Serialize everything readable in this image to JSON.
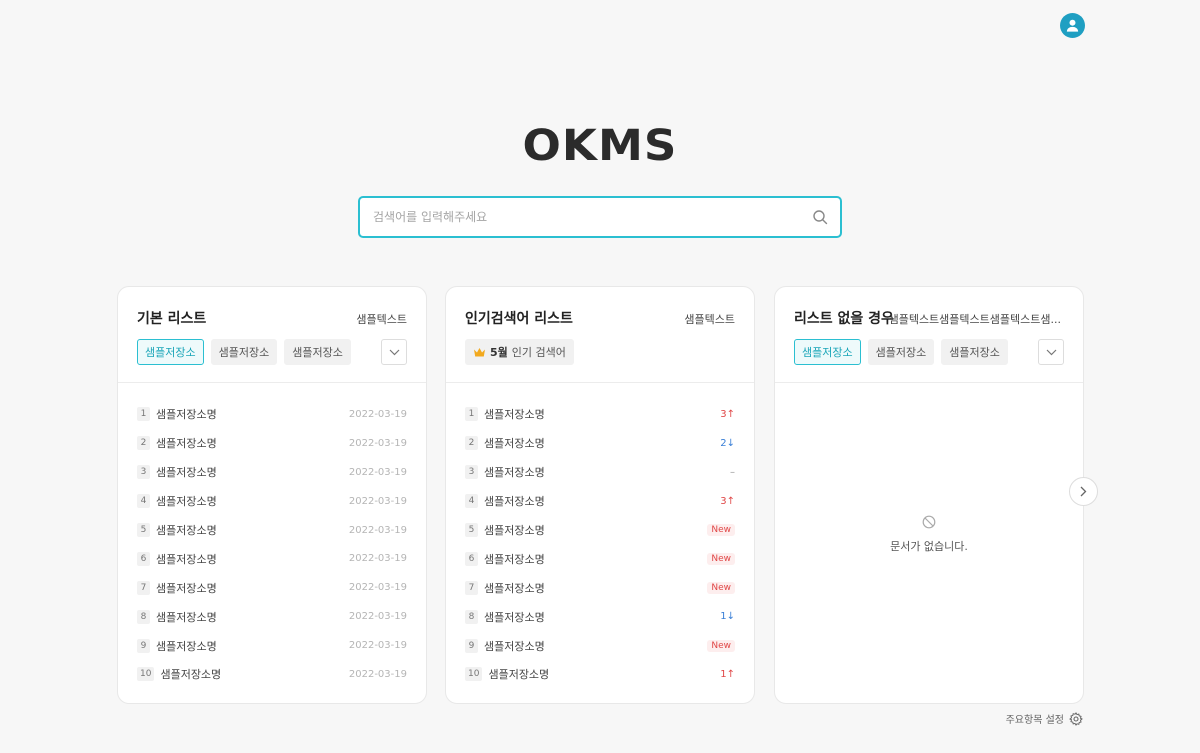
{
  "header": {
    "avatar_icon": "user-avatar-icon"
  },
  "logo": {
    "text": "OKMS"
  },
  "search": {
    "placeholder": "검색어를 입력해주세요",
    "value": "",
    "icon": "search-icon"
  },
  "cards": [
    {
      "title": "기본 리스트",
      "sub": "샘플텍스트",
      "tags": [
        "샘플저장소",
        "샘플저장소",
        "샘플저장소"
      ],
      "items": [
        {
          "rank": "1",
          "name": "샘플저장소명",
          "date": "2022-03-19"
        },
        {
          "rank": "2",
          "name": "샘플저장소명",
          "date": "2022-03-19"
        },
        {
          "rank": "3",
          "name": "샘플저장소명",
          "date": "2022-03-19"
        },
        {
          "rank": "4",
          "name": "샘플저장소명",
          "date": "2022-03-19"
        },
        {
          "rank": "5",
          "name": "샘플저장소명",
          "date": "2022-03-19"
        },
        {
          "rank": "6",
          "name": "샘플저장소명",
          "date": "2022-03-19"
        },
        {
          "rank": "7",
          "name": "샘플저장소명",
          "date": "2022-03-19"
        },
        {
          "rank": "8",
          "name": "샘플저장소명",
          "date": "2022-03-19"
        },
        {
          "rank": "9",
          "name": "샘플저장소명",
          "date": "2022-03-19"
        },
        {
          "rank": "10",
          "name": "샘플저장소명",
          "date": "2022-03-19"
        }
      ]
    },
    {
      "title": "인기검색어 리스트",
      "sub": "샘플텍스트",
      "month_label": "5월",
      "month_suffix": "인기 검색어",
      "items": [
        {
          "rank": "1",
          "name": "샘플저장소명",
          "change": "3↑",
          "kind": "up"
        },
        {
          "rank": "2",
          "name": "샘플저장소명",
          "change": "2↓",
          "kind": "down"
        },
        {
          "rank": "3",
          "name": "샘플저장소명",
          "change": "–",
          "kind": "same"
        },
        {
          "rank": "4",
          "name": "샘플저장소명",
          "change": "3↑",
          "kind": "up"
        },
        {
          "rank": "5",
          "name": "샘플저장소명",
          "change": "New",
          "kind": "new"
        },
        {
          "rank": "6",
          "name": "샘플저장소명",
          "change": "New",
          "kind": "new"
        },
        {
          "rank": "7",
          "name": "샘플저장소명",
          "change": "New",
          "kind": "new"
        },
        {
          "rank": "8",
          "name": "샘플저장소명",
          "change": "1↓",
          "kind": "down"
        },
        {
          "rank": "9",
          "name": "샘플저장소명",
          "change": "New",
          "kind": "new"
        },
        {
          "rank": "10",
          "name": "샘플저장소명",
          "change": "1↑",
          "kind": "up"
        }
      ]
    },
    {
      "title": "리스트 없을 경우",
      "sub": "샘플텍스트샘플텍스트샘플텍스트샘...",
      "tags": [
        "샘플저장소",
        "샘플저장소",
        "샘플저장소"
      ],
      "empty_text": "문서가 없습니다."
    }
  ],
  "footer": {
    "settings_label": "주요항목 설정"
  },
  "colors": {
    "accent": "#2bbfd1",
    "up": "#e04848",
    "down": "#3a7fd6"
  }
}
